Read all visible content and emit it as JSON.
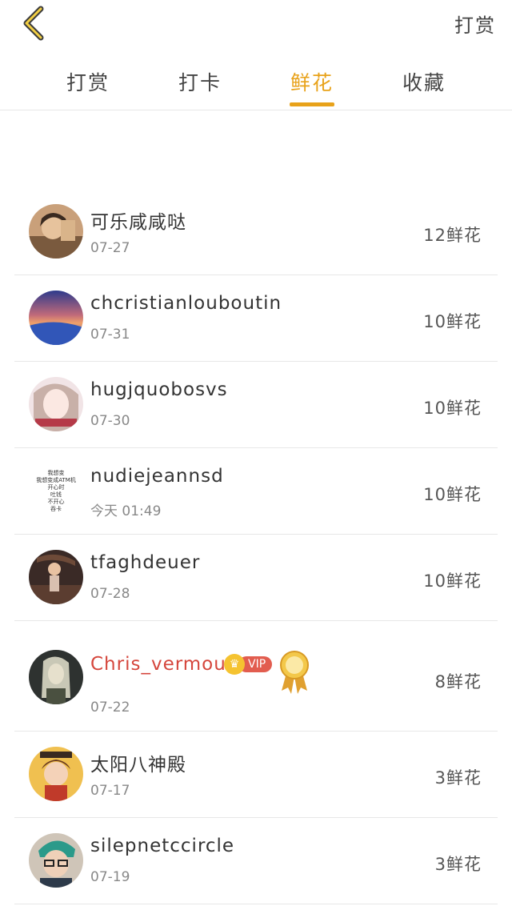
{
  "header": {
    "back_icon": "chevron-left-icon",
    "action_label": "打赏"
  },
  "tabs": [
    {
      "label": "打赏",
      "active": false
    },
    {
      "label": "打卡",
      "active": false
    },
    {
      "label": "鲜花",
      "active": true
    },
    {
      "label": "收藏",
      "active": false
    }
  ],
  "list": [
    {
      "name": "可乐咸咸哒",
      "date": "07-27",
      "count": "12鲜花"
    },
    {
      "name": "chcristianlouboutin",
      "date": "07-31",
      "count": "10鲜花"
    },
    {
      "name": "hugjquobosvs",
      "date": "07-30",
      "count": "10鲜花"
    },
    {
      "name": "nudiejeannsd",
      "date": "今天 01:49",
      "count": "10鲜花",
      "avatar_text": [
        "我想变",
        "我想变成ATM机",
        "开心时",
        "吐钱",
        "不开心",
        "吞卡"
      ]
    },
    {
      "name": "tfaghdeuer",
      "date": "07-28",
      "count": "10鲜花"
    },
    {
      "name": "Chris_vermouth",
      "date": "07-22",
      "count": "8鲜花",
      "vip_label": "VIP"
    },
    {
      "name": "太阳八神殿",
      "date": "07-17",
      "count": "3鲜花"
    },
    {
      "name": "silepnetccircle",
      "date": "07-19",
      "count": "3鲜花"
    }
  ],
  "colors": {
    "accent": "#e8a21a",
    "vip_name": "#d5463c"
  }
}
